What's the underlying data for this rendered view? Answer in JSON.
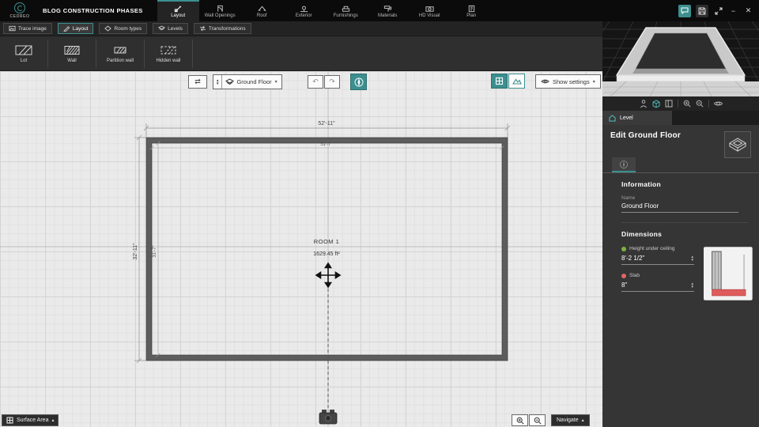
{
  "topbar": {
    "logo_text": "CEDREO",
    "project_title": "BLOG CONSTRUCTION PHASES",
    "tabs": [
      {
        "label": "Layout",
        "active": true
      },
      {
        "label": "Wall Openings",
        "active": false
      },
      {
        "label": "Roof",
        "active": false
      },
      {
        "label": "Exterior",
        "active": false
      },
      {
        "label": "Furnishings",
        "active": false
      },
      {
        "label": "Materials",
        "active": false
      },
      {
        "label": "HD Visual",
        "active": false
      },
      {
        "label": "Plan",
        "active": false
      }
    ]
  },
  "subtabs": [
    {
      "label": "Trace image",
      "active": false
    },
    {
      "label": "Layout",
      "active": true
    },
    {
      "label": "Room types",
      "active": false
    },
    {
      "label": "Levels",
      "active": false
    },
    {
      "label": "Transformations",
      "active": false
    }
  ],
  "tools": [
    {
      "label": "Lot"
    },
    {
      "label": "Wall"
    },
    {
      "label": "Partition wall"
    },
    {
      "label": "Hidden wall"
    }
  ],
  "canvas_toolbar": {
    "level_selector": "Ground Floor",
    "show_settings": "Show settings"
  },
  "canvas_footer": {
    "surface_area": "Surface Area",
    "navigate": "Navigate"
  },
  "plan": {
    "room_name": "ROOM 1",
    "room_area": "1629.45 ft²",
    "dim_width_outer": "52'-11\"",
    "dim_width_inner": "51'-7\"",
    "dim_height_outer": "32'-11\"",
    "dim_height_inner": "31'-7\""
  },
  "panel": {
    "tab_label": "Level",
    "title": "Edit Ground Floor",
    "information": {
      "heading": "Information",
      "name_label": "Name",
      "name_value": "Ground Floor"
    },
    "dimensions": {
      "heading": "Dimensions",
      "height_label": "Height under ceiling",
      "height_value": "8'-2 1/2\"",
      "slab_label": "Slab",
      "slab_value": "8\""
    }
  },
  "colors": {
    "accent": "#3d8f8f",
    "slab_red": "#e05c5c",
    "height_green": "#7cb342"
  }
}
